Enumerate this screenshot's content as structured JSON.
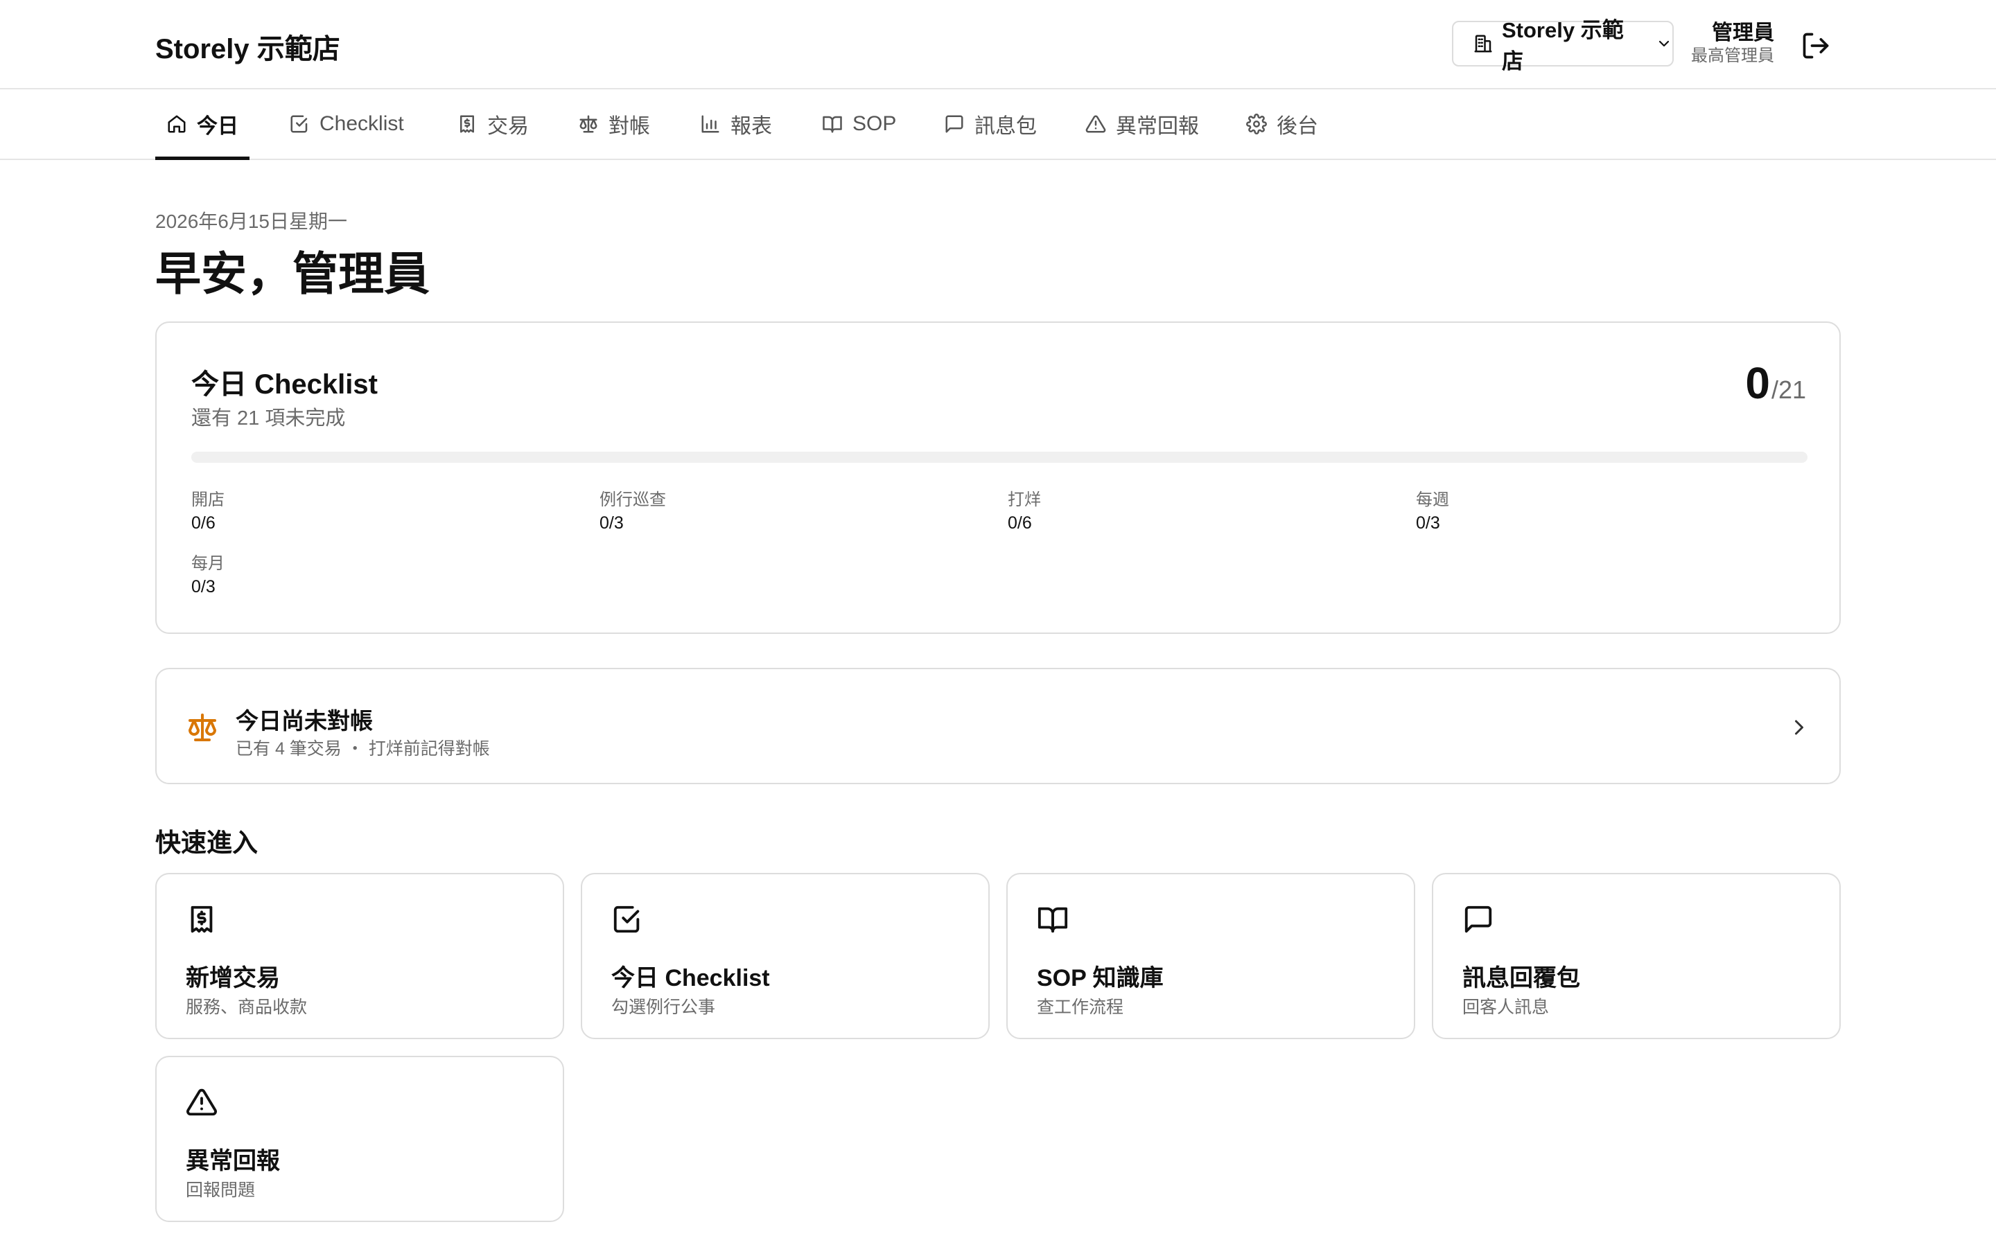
{
  "header": {
    "brand": "Storely 示範店",
    "store_select": "Storely 示範店",
    "user_name": "管理員",
    "user_role": "最高管理員"
  },
  "tabs": [
    {
      "label": "今日",
      "icon": "home-icon",
      "active": true
    },
    {
      "label": "Checklist",
      "icon": "checkbox-icon"
    },
    {
      "label": "交易",
      "icon": "receipt-icon"
    },
    {
      "label": "對帳",
      "icon": "scale-icon"
    },
    {
      "label": "報表",
      "icon": "bar-chart-icon"
    },
    {
      "label": "SOP",
      "icon": "book-icon"
    },
    {
      "label": "訊息包",
      "icon": "message-icon"
    },
    {
      "label": "異常回報",
      "icon": "warning-icon"
    },
    {
      "label": "後台",
      "icon": "gear-icon"
    }
  ],
  "main": {
    "date": "2026年6月15日星期一",
    "greeting": "早安，管理員"
  },
  "checklist": {
    "title": "今日 Checklist",
    "subtitle": "還有 21 項未完成",
    "done": "0",
    "total": "/21",
    "progress_fraction": 0,
    "stats": [
      {
        "label": "開店",
        "value": "0/6"
      },
      {
        "label": "例行巡查",
        "value": "0/3"
      },
      {
        "label": "打烊",
        "value": "0/6"
      },
      {
        "label": "每週",
        "value": "0/3"
      },
      {
        "label": "每月",
        "value": "0/3"
      }
    ]
  },
  "reconciliation": {
    "title": "今日尚未對帳",
    "subtitle": "已有 4 筆交易 ・ 打烊前記得對帳",
    "accent": "#d97706"
  },
  "quick_access": {
    "title": "快速進入",
    "items": [
      {
        "title": "新增交易",
        "subtitle": "服務、商品收款",
        "icon": "receipt-icon"
      },
      {
        "title": "今日 Checklist",
        "subtitle": "勾選例行公事",
        "icon": "checkbox-icon"
      },
      {
        "title": "SOP 知識庫",
        "subtitle": "查工作流程",
        "icon": "book-icon"
      },
      {
        "title": "訊息回覆包",
        "subtitle": "回客人訊息",
        "icon": "message-icon"
      },
      {
        "title": "異常回報",
        "subtitle": "回報問題",
        "icon": "warning-icon"
      }
    ]
  }
}
